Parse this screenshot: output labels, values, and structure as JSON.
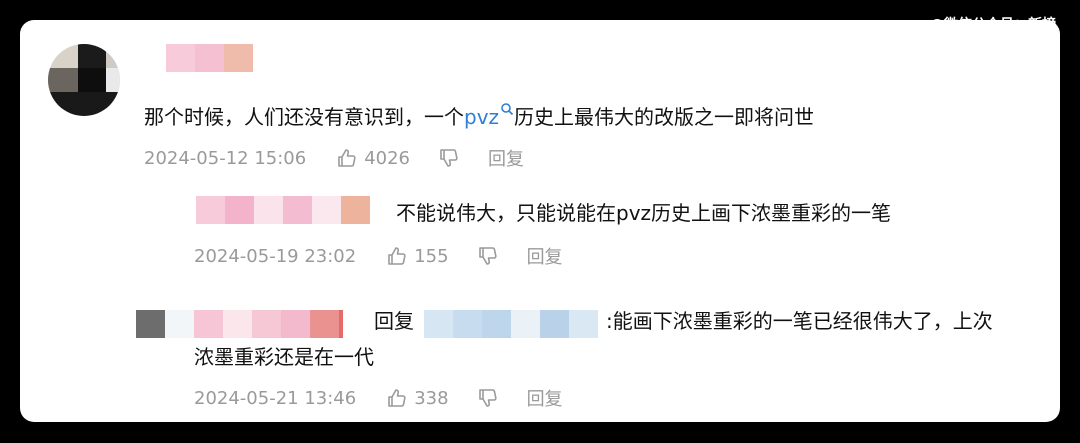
{
  "watermark": "@微信公众号：新榜",
  "comment": {
    "text_before": "那个时候，人们还没有意识到，一个",
    "link": "pvz",
    "text_after": "历史上最伟大的改版之一即将问世",
    "time": "2024-05-12 15:06",
    "likes": "4026",
    "reply_label": "回复"
  },
  "reply1": {
    "text": "不能说伟大，只能说能在pvz历史上画下浓墨重彩的一笔",
    "time": "2024-05-19 23:02",
    "likes": "155",
    "reply_label": "回复"
  },
  "reply2": {
    "reply_word": "回复",
    "line1": ":能画下浓墨重彩的一笔已经很伟大了，上次",
    "line2": "浓墨重彩还是在一代",
    "time": "2024-05-21 13:46",
    "likes": "338",
    "reply_label": "回复"
  },
  "icons": [
    "search-icon",
    "thumbs-up-icon",
    "thumbs-down-icon"
  ],
  "colors": {
    "link": "#2f7fd6",
    "meta": "#9a9a9a",
    "text": "#111111"
  }
}
